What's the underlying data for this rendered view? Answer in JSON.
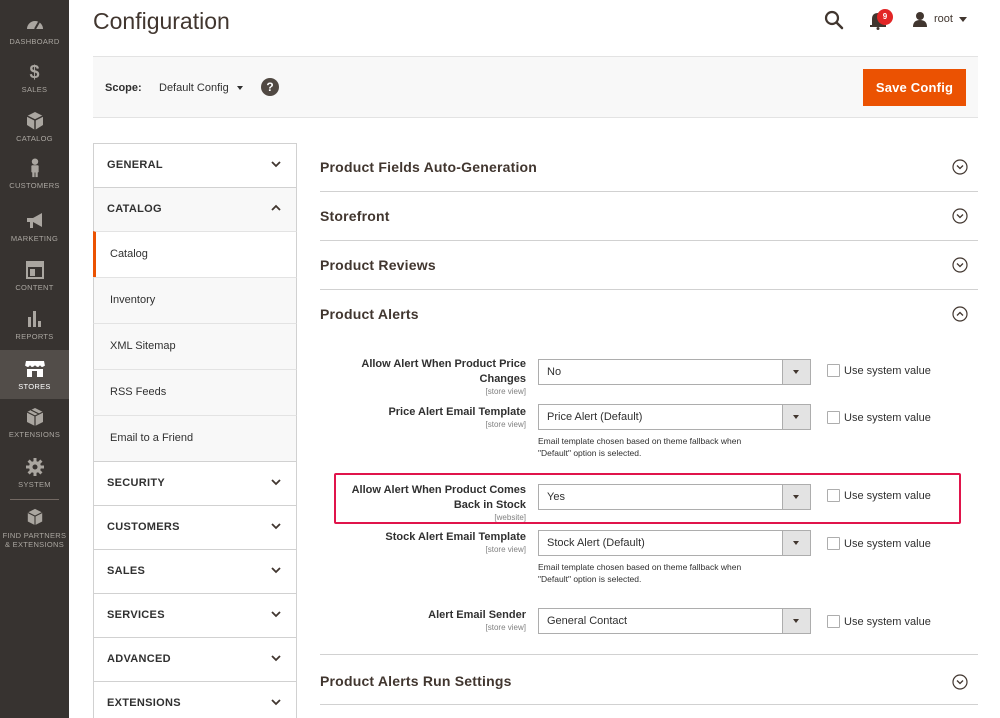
{
  "nav": {
    "dashboard": "DASHBOARD",
    "sales": "SALES",
    "catalog": "CATALOG",
    "customers": "CUSTOMERS",
    "marketing": "MARKETING",
    "content": "CONTENT",
    "reports": "REPORTS",
    "stores": "STORES",
    "extensions": "EXTENSIONS",
    "system": "SYSTEM",
    "partners_line1": "FIND PARTNERS",
    "partners_line2": "& EXTENSIONS"
  },
  "header": {
    "title": "Configuration",
    "notification_count": "9",
    "user": "root"
  },
  "scope": {
    "label": "Scope:",
    "value": "Default Config",
    "help": "?",
    "save_label": "Save Config"
  },
  "tabs": {
    "general": "GENERAL",
    "catalog": "CATALOG",
    "catalog_items": [
      "Catalog",
      "Inventory",
      "XML Sitemap",
      "RSS Feeds",
      "Email to a Friend"
    ],
    "security": "SECURITY",
    "customers": "CUSTOMERS",
    "sales": "SALES",
    "services": "SERVICES",
    "advanced": "ADVANCED",
    "extensions": "EXTENSIONS"
  },
  "sections": {
    "auto_generation": "Product Fields Auto-Generation",
    "storefront": "Storefront",
    "reviews": "Product Reviews",
    "alerts": "Product Alerts",
    "run_settings": "Product Alerts Run Settings"
  },
  "fields": {
    "price_alert": {
      "label_1": "Allow Alert When Product Price",
      "label_2": "Changes",
      "scope": "[store view]",
      "value": "No"
    },
    "price_template": {
      "label": "Price Alert Email Template",
      "scope": "[store view]",
      "value": "Price Alert (Default)",
      "note_1": "Email template chosen based on theme fallback when",
      "note_2": "\"Default\" option is selected."
    },
    "stock_alert": {
      "label_1": "Allow Alert When Product Comes",
      "label_2": "Back in Stock",
      "scope": "[website]",
      "value": "Yes"
    },
    "stock_template": {
      "label": "Stock Alert Email Template",
      "scope": "[store view]",
      "value": "Stock Alert (Default)",
      "note_1": "Email template chosen based on theme fallback when",
      "note_2": "\"Default\" option is selected."
    },
    "sender": {
      "label": "Alert Email Sender",
      "scope": "[store view]",
      "value": "General Contact"
    },
    "use_system_value": "Use system value"
  }
}
